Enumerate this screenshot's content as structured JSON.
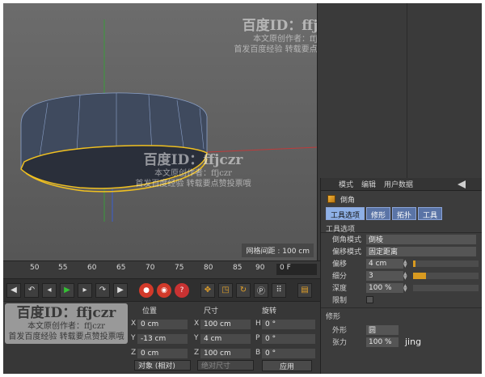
{
  "viewport": {
    "grid_readout": "网格间距 : 100 cm"
  },
  "attributes": {
    "menu": [
      "模式",
      "编辑",
      "用户数据"
    ],
    "object_name": "倒角",
    "tabs": [
      "工具选项",
      "修形",
      "拓扑",
      "工具"
    ],
    "active_tab_index": 0,
    "section_title": "工具选项",
    "fields": {
      "bevel_mode_label": "倒角模式",
      "bevel_mode_value": "倒棱",
      "offset_mode_label": "偏移模式",
      "offset_mode_value": "固定距离",
      "offset_label": "偏移",
      "offset_value": "4 cm",
      "offset_fill": 0.04,
      "subdivision_label": "细分",
      "subdivision_value": "3",
      "subdivision_fill": 0.2,
      "depth_label": "深度",
      "depth_value": "100 %",
      "limit_label": "限制"
    },
    "shape_section": "修形",
    "shape_label": "外形",
    "shape_value": "圆",
    "tension_label": "张力",
    "tension_value": "100 %"
  },
  "timeline": {
    "ticks": [
      "50",
      "55",
      "60",
      "65",
      "70",
      "75",
      "80",
      "85",
      "90"
    ],
    "frame_field": "0 F"
  },
  "coords": {
    "headers": [
      "位置",
      "尺寸",
      "旋转"
    ],
    "position": [
      {
        "axis": "X",
        "value": "0 cm"
      },
      {
        "axis": "Y",
        "value": "-13 cm"
      },
      {
        "axis": "Z",
        "value": "0 cm"
      }
    ],
    "size": [
      {
        "axis": "X",
        "value": "100 cm"
      },
      {
        "axis": "Y",
        "value": "4 cm"
      },
      {
        "axis": "Z",
        "value": "100 cm"
      }
    ],
    "rotation": [
      {
        "axis": "H",
        "value": "0 °"
      },
      {
        "axis": "P",
        "value": "0 °"
      },
      {
        "axis": "B",
        "value": "0 °"
      }
    ],
    "mode_select": "对象 (相对)",
    "size_select": "绝对尺寸",
    "apply_label": "应用"
  },
  "watermarks": {
    "title": "百度ID：ffjczr",
    "line1": "本文原创作者：ffjczr",
    "line2": "首发百度经验  转载要点赞投票哦",
    "corner_text": "jing"
  }
}
